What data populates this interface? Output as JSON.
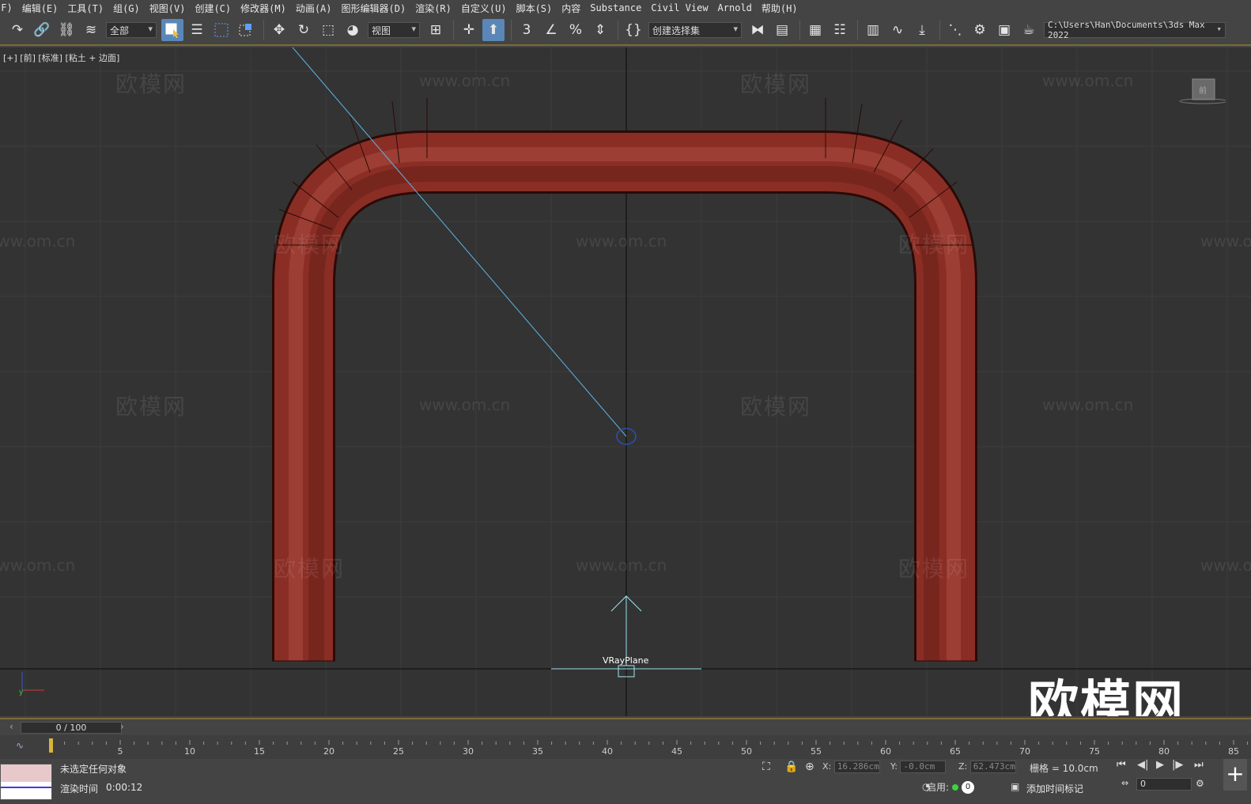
{
  "menu": [
    "(F)",
    "编辑(E)",
    "工具(T)",
    "组(G)",
    "视图(V)",
    "创建(C)",
    "修改器(M)",
    "动画(A)",
    "图形编辑器(D)",
    "渲染(R)",
    "自定义(U)",
    "脚本(S)",
    "内容",
    "Substance",
    "Civil View",
    "Arnold",
    "帮助(H)"
  ],
  "toolbar": {
    "selection_filter": "全部",
    "reference_coord": "视图",
    "named_selection": "创建选择集",
    "project_path": "C:\\Users\\Han\\Documents\\3ds Max 2022"
  },
  "viewport": {
    "label": "[+] [前] [标准] [粘土 + 边面]",
    "object_label": "VRayPlane",
    "watermark_text": "www.om.cn",
    "watermark_brand": "欧模网",
    "brand_logo": "欧模网",
    "viewcube_label": "前",
    "pipe_color": "#8e2f26",
    "bg_color": "#333333",
    "grid_color": "#3e3e3e"
  },
  "timeline": {
    "frame_display": "0 / 100",
    "ticks": [
      "5",
      "10",
      "15",
      "20",
      "25",
      "30",
      "35",
      "40",
      "45",
      "50",
      "55",
      "60",
      "65",
      "70",
      "75",
      "80",
      "85"
    ]
  },
  "status": {
    "selection": "未选定任何对象",
    "render_time_label": "渲染时间",
    "render_time": "0:00:12",
    "x_label": "X:",
    "x_value": "16.286cm",
    "y_label": "Y:",
    "y_value": "-0.0cm",
    "z_label": "Z:",
    "z_value": "62.473cm",
    "grid": "栅格 = 10.0cm",
    "enable_label": "启用:",
    "enable_count": "0",
    "add_time_tag": "添加时间标记",
    "current_frame": "0"
  }
}
